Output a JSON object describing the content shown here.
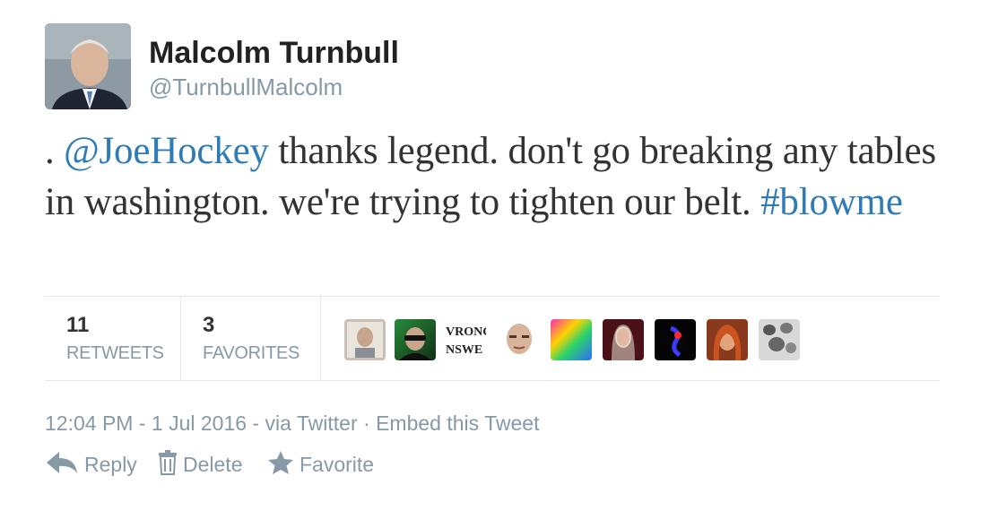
{
  "user": {
    "name": "Malcolm Turnbull",
    "handle": "@TurnbullMalcolm"
  },
  "tweet": {
    "prefix": ". ",
    "mention": "@JoeHockey",
    "body": " thanks legend. don't go breaking any tables in washington. we're trying to tighten our belt. ",
    "hashtag": "#blowme"
  },
  "stats": {
    "retweets_count": "11",
    "retweets_label": "RETWEETS",
    "favorites_count": "3",
    "favorites_label": "FAVORITES"
  },
  "favoriters": {
    "text_avatar_line1": "VRONG",
    "text_avatar_line2": "NSWE"
  },
  "meta": {
    "time": "12:04 PM",
    "sep1": " - ",
    "date": "1 Jul 2016",
    "sep2": " - ",
    "via": "via Twitter",
    "sep3": " · ",
    "embed": "Embed this Tweet"
  },
  "actions": {
    "reply": "Reply",
    "delete": "Delete",
    "favorite": "Favorite"
  },
  "colors": {
    "link": "#2e7bb5",
    "muted": "#8899a6",
    "divider": "#e1e8ed"
  }
}
